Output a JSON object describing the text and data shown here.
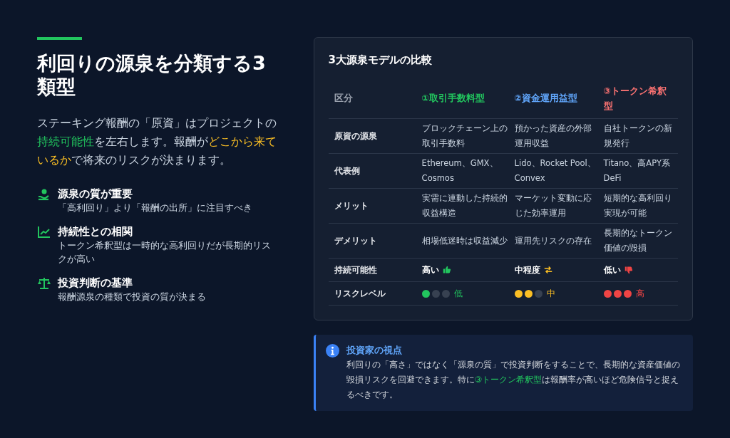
{
  "heading": {
    "title": "利回りの源泉を分類する3類型"
  },
  "intro": [
    {
      "text": "ステーキング報酬の「原資」はプロジェクトの",
      "kind": "plain"
    },
    {
      "text": "持続可能性",
      "kind": "positive"
    },
    {
      "text": "を左右します。報酬が",
      "kind": "plain"
    },
    {
      "text": "どこから来ているか",
      "kind": "warning"
    },
    {
      "text": "で将来のリスクが決まります。",
      "kind": "plain"
    }
  ],
  "points": [
    {
      "title": "源泉の質が重要",
      "text": "「高利回り」より「報酬の出所」に注目すべき"
    },
    {
      "title": "持続性との相関",
      "text": "トークン希釈型は一時的な高利回りだが長期的リスクが高い"
    },
    {
      "title": "投資判断の基準",
      "text": "報酬源泉の種類で投資の質が決まる"
    }
  ],
  "comparison": {
    "title": "3大源泉モデルの比較",
    "columns": [
      {
        "text": "区分",
        "color": "#9ca3af"
      },
      {
        "text": "①取引手数料型",
        "color": "#22c55e"
      },
      {
        "text": "②資金運用益型",
        "color": "#60a5fa"
      },
      {
        "text": "③トークン希釈型",
        "color": "#f87171"
      }
    ],
    "rows": [
      {
        "kind": "text",
        "cells": [
          "原資の源泉",
          "ブロックチェーン上の取引手数料",
          "預かった資産の外部運用収益",
          "自社トークンの新規発行"
        ]
      },
      {
        "kind": "text",
        "cells": [
          "代表例",
          "Ethereum、GMX、Cosmos",
          "Lido、Rocket Pool、Convex",
          "Titano、高APY系DeFi"
        ]
      },
      {
        "kind": "text",
        "cells": [
          "メリット",
          "実需に連動した持続的収益構造",
          "マーケット変動に応じた効率運用",
          "短期的な高利回り実現が可能"
        ]
      },
      {
        "kind": "text",
        "cells": [
          "デメリット",
          "相場低迷時は収益減少",
          "運用先リスクの存在",
          "長期的なトークン価値の毀損"
        ]
      },
      {
        "kind": "rating",
        "cells": [
          "持続可能性",
          {
            "text": "高い",
            "color": "#22c55e"
          },
          {
            "text": "中程度",
            "color": "#fbbf24"
          },
          {
            "text": "低い",
            "color": "#ef4444"
          }
        ]
      },
      {
        "kind": "risk",
        "cells": [
          "リスクレベル",
          {
            "text": "低",
            "stars": 1,
            "color": "#22c55e"
          },
          {
            "text": "中",
            "stars": 2,
            "color": "#fbbf24"
          },
          {
            "text": "高",
            "stars": 3,
            "color": "#ef4444"
          }
        ]
      }
    ]
  },
  "note": {
    "title": "投資家の視点",
    "body": [
      {
        "text": "利回りの「高さ」ではなく「源泉の質」で投資判断をすることで、長期的な資産価値の毀損リスクを回避できます。特に",
        "kind": "plain"
      },
      {
        "text": "③トークン希釈型",
        "kind": "positive"
      },
      {
        "text": "は報酬率が高いほど危険信号と捉えるべきです。",
        "kind": "plain"
      }
    ]
  }
}
